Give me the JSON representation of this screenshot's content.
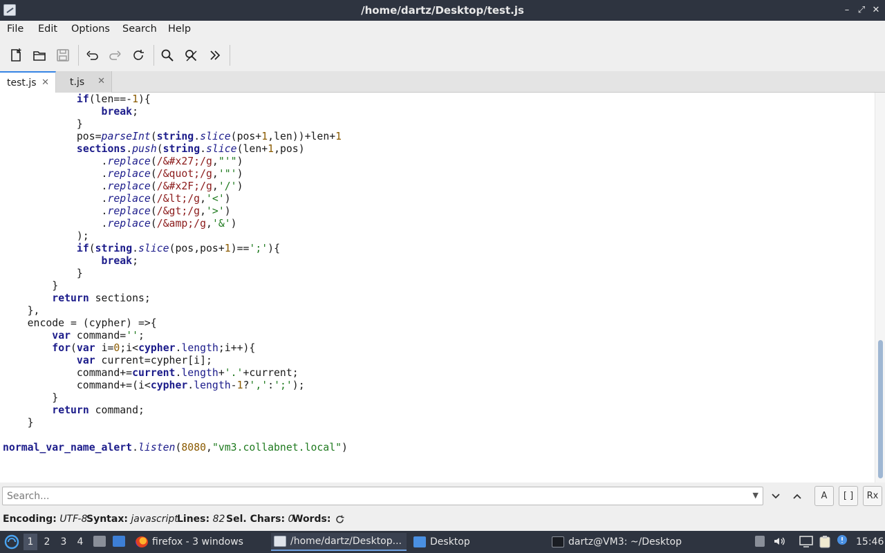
{
  "window": {
    "title": "/home/dartz/Desktop/test.js",
    "controls": [
      "–",
      "⤢",
      "✕"
    ]
  },
  "menu": [
    "File",
    "Edit",
    "Options",
    "Search",
    "Help"
  ],
  "tabs": [
    {
      "label": "test.js",
      "close": "✕"
    },
    {
      "label": "t.js",
      "close": "✕"
    }
  ],
  "code_lines": [
    [
      [
        "            ",
        ""
      ],
      [
        "if",
        "kw"
      ],
      [
        "(len==-",
        ""
      ],
      [
        "1",
        "num"
      ],
      [
        "){",
        ""
      ]
    ],
    [
      [
        "                ",
        ""
      ],
      [
        "break",
        "kw"
      ],
      [
        ";",
        ""
      ]
    ],
    [
      [
        "            }",
        ""
      ]
    ],
    [
      [
        "            pos=",
        ""
      ],
      [
        "parseInt",
        "fn"
      ],
      [
        "(",
        ""
      ],
      [
        "string",
        "kw"
      ],
      [
        ".",
        ""
      ],
      [
        "slice",
        "fn"
      ],
      [
        "(pos+",
        ""
      ],
      [
        "1",
        "num"
      ],
      [
        ",len))+len+",
        ""
      ],
      [
        "1",
        "num"
      ]
    ],
    [
      [
        "            ",
        ""
      ],
      [
        "sections",
        "kw"
      ],
      [
        ".",
        ""
      ],
      [
        "push",
        "fn"
      ],
      [
        "(",
        ""
      ],
      [
        "string",
        "kw"
      ],
      [
        ".",
        ""
      ],
      [
        "slice",
        "fn"
      ],
      [
        "(len+",
        ""
      ],
      [
        "1",
        "num"
      ],
      [
        ",pos)",
        ""
      ]
    ],
    [
      [
        "                .",
        ""
      ],
      [
        "replace",
        "fn"
      ],
      [
        "(",
        ""
      ],
      [
        "/&#x27;/g",
        "rx"
      ],
      [
        ",",
        ""
      ],
      [
        "\"'\"",
        "str"
      ],
      [
        ")",
        ""
      ]
    ],
    [
      [
        "                .",
        ""
      ],
      [
        "replace",
        "fn"
      ],
      [
        "(",
        ""
      ],
      [
        "/&quot;/g",
        "rx"
      ],
      [
        ",",
        ""
      ],
      [
        "'\"'",
        "str"
      ],
      [
        ")",
        ""
      ]
    ],
    [
      [
        "                .",
        ""
      ],
      [
        "replace",
        "fn"
      ],
      [
        "(",
        ""
      ],
      [
        "/&#x2F;/g",
        "rx"
      ],
      [
        ",",
        ""
      ],
      [
        "'/'",
        "str"
      ],
      [
        ")",
        ""
      ]
    ],
    [
      [
        "                .",
        ""
      ],
      [
        "replace",
        "fn"
      ],
      [
        "(",
        ""
      ],
      [
        "/&lt;/g",
        "rx"
      ],
      [
        ",",
        ""
      ],
      [
        "'<'",
        "str"
      ],
      [
        ")",
        ""
      ]
    ],
    [
      [
        "                .",
        ""
      ],
      [
        "replace",
        "fn"
      ],
      [
        "(",
        ""
      ],
      [
        "/&gt;/g",
        "rx"
      ],
      [
        ",",
        ""
      ],
      [
        "'>'",
        "str"
      ],
      [
        ")",
        ""
      ]
    ],
    [
      [
        "                .",
        ""
      ],
      [
        "replace",
        "fn"
      ],
      [
        "(",
        ""
      ],
      [
        "/&amp;/g",
        "rx"
      ],
      [
        ",",
        ""
      ],
      [
        "'&'",
        "str"
      ],
      [
        ")",
        ""
      ]
    ],
    [
      [
        "            );",
        ""
      ]
    ],
    [
      [
        "            ",
        ""
      ],
      [
        "if",
        "kw"
      ],
      [
        "(",
        ""
      ],
      [
        "string",
        "kw"
      ],
      [
        ".",
        ""
      ],
      [
        "slice",
        "fn"
      ],
      [
        "(pos,pos+",
        ""
      ],
      [
        "1",
        "num"
      ],
      [
        ")==",
        ""
      ],
      [
        "';'",
        "str"
      ],
      [
        "){",
        ""
      ]
    ],
    [
      [
        "                ",
        ""
      ],
      [
        "break",
        "kw"
      ],
      [
        ";",
        ""
      ]
    ],
    [
      [
        "            }",
        ""
      ]
    ],
    [
      [
        "        }",
        ""
      ]
    ],
    [
      [
        "        ",
        ""
      ],
      [
        "return",
        "kw"
      ],
      [
        " sections;",
        ""
      ]
    ],
    [
      [
        "    },",
        ""
      ]
    ],
    [
      [
        "    encode = (cypher) =>{",
        ""
      ]
    ],
    [
      [
        "        ",
        ""
      ],
      [
        "var",
        "kw"
      ],
      [
        " command=",
        ""
      ],
      [
        "''",
        "str"
      ],
      [
        ";",
        ""
      ]
    ],
    [
      [
        "        ",
        ""
      ],
      [
        "for",
        "kw"
      ],
      [
        "(",
        ""
      ],
      [
        "var",
        "kw"
      ],
      [
        " i=",
        ""
      ],
      [
        "0",
        "num"
      ],
      [
        ";i<",
        ""
      ],
      [
        "cypher",
        "kw"
      ],
      [
        ".",
        ""
      ],
      [
        "length",
        "mem"
      ],
      [
        ";i++){",
        ""
      ]
    ],
    [
      [
        "            ",
        ""
      ],
      [
        "var",
        "kw"
      ],
      [
        " current=cypher[i];",
        ""
      ]
    ],
    [
      [
        "            command+=",
        ""
      ],
      [
        "current",
        "kw"
      ],
      [
        ".",
        ""
      ],
      [
        "length",
        "mem"
      ],
      [
        "+",
        ""
      ],
      [
        "'.'",
        "str"
      ],
      [
        "+current;",
        ""
      ]
    ],
    [
      [
        "            command+=(i<",
        ""
      ],
      [
        "cypher",
        "kw"
      ],
      [
        ".",
        ""
      ],
      [
        "length",
        "mem"
      ],
      [
        "-",
        ""
      ],
      [
        "1",
        "num"
      ],
      [
        "?",
        ""
      ],
      [
        "','",
        "str"
      ],
      [
        ":",
        ""
      ],
      [
        "';'",
        "str"
      ],
      [
        ");",
        ""
      ]
    ],
    [
      [
        "        }",
        ""
      ]
    ],
    [
      [
        "        ",
        ""
      ],
      [
        "return",
        "kw"
      ],
      [
        " command;",
        ""
      ]
    ],
    [
      [
        "    }",
        ""
      ]
    ],
    [
      [
        "",
        ""
      ]
    ],
    [
      [
        "normal_var_name_alert",
        "kw"
      ],
      [
        ".",
        ""
      ],
      [
        "listen",
        "fn"
      ],
      [
        "(",
        ""
      ],
      [
        "8080",
        "num"
      ],
      [
        ",",
        ""
      ],
      [
        "\"vm3.collabnet.local\"",
        "str"
      ],
      [
        ")",
        ""
      ]
    ]
  ],
  "search": {
    "placeholder": "Search...",
    "buttons": [
      "⌄",
      "⌃",
      "A",
      "[ ]",
      "Rx"
    ]
  },
  "status": {
    "encoding_label": "Encoding:",
    "encoding": "UTF-8",
    "syntax_label": "Syntax:",
    "syntax": "javascript",
    "lines_label": "Lines:",
    "lines": "82",
    "selchars_label": "Sel. Chars:",
    "selchars": "0",
    "words_label": "Words:"
  },
  "taskbar": {
    "workspaces": [
      "1",
      "2",
      "3",
      "4"
    ],
    "tasks": [
      {
        "label": "firefox - 3 windows"
      },
      {
        "label": "/home/dartz/Desktop..."
      },
      {
        "label": "Desktop"
      },
      {
        "label": "dartz@VM3: ~/Desktop"
      }
    ],
    "clock": "15:46"
  }
}
